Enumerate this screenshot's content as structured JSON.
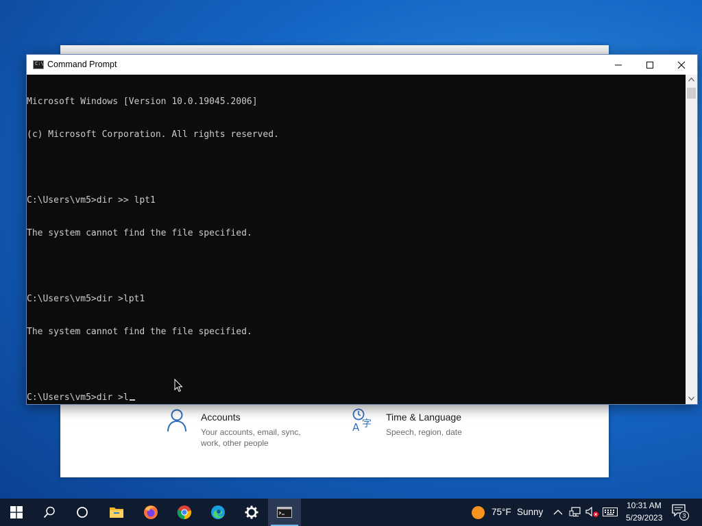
{
  "cmd_window": {
    "title": "Command Prompt",
    "lines": [
      "Microsoft Windows [Version 10.0.19045.2006]",
      "(c) Microsoft Corporation. All rights reserved.",
      "",
      "C:\\Users\\vm5>dir >> lpt1",
      "The system cannot find the file specified.",
      "",
      "C:\\Users\\vm5>dir >lpt1",
      "The system cannot find the file specified.",
      ""
    ],
    "current_input": "C:\\Users\\vm5>dir >l"
  },
  "settings_window": {
    "tiles": [
      {
        "title": "Accounts",
        "desc": "Your accounts, email, sync, work, other people",
        "icon": "person-icon"
      },
      {
        "title": "Time & Language",
        "desc": "Speech, region, date",
        "icon": "time-language-icon"
      }
    ]
  },
  "taskbar": {
    "apps": [
      "start",
      "search",
      "cortana",
      "file-explorer",
      "firefox",
      "chrome",
      "edge",
      "settings",
      "command-prompt"
    ],
    "weather": {
      "temp": "75°F",
      "condition": "Sunny"
    },
    "clock": {
      "time": "10:31 AM",
      "date": "5/29/2023"
    },
    "notification_count": "3"
  },
  "colors": {
    "console_bg": "#0c0c0c",
    "console_text": "#cccccc",
    "taskbar_bg": "#0f1c30",
    "accent": "#76b9ed"
  }
}
